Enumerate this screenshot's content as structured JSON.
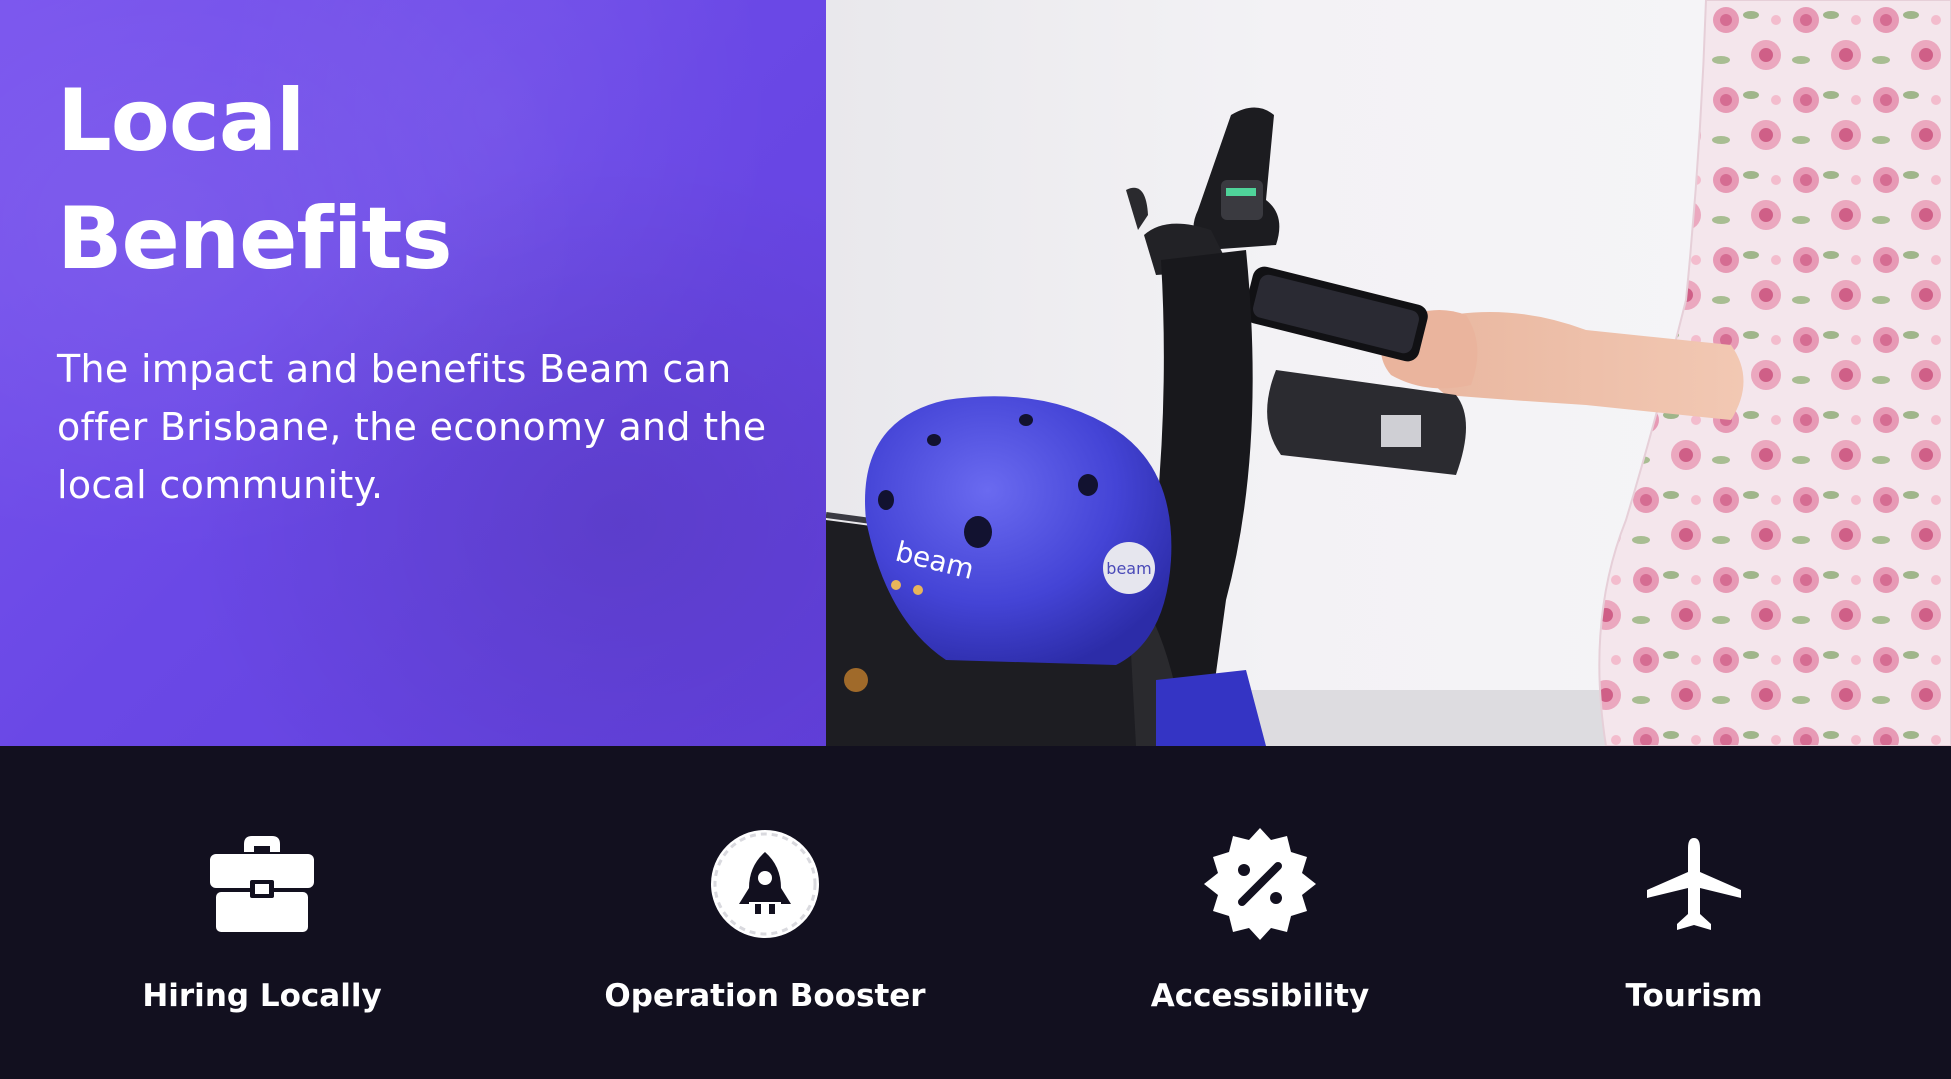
{
  "hero": {
    "title_line1": "Local",
    "title_line2": "Benefits",
    "description": "The impact and benefits Beam can offer Brisbane, the economy and the local community."
  },
  "photo": {
    "helmet_brand": "beam",
    "helmet_sticker": "beam"
  },
  "features": [
    {
      "label": "Hiring Locally",
      "icon": "briefcase-icon"
    },
    {
      "label": "Operation  Booster",
      "icon": "rocket-icon"
    },
    {
      "label": "Accessibility",
      "icon": "discount-badge-icon"
    },
    {
      "label": "Tourism",
      "icon": "airplane-icon"
    }
  ],
  "colors": {
    "purple_panel": "#6a48e6",
    "dark_band": "#12101f",
    "helmet_blue": "#4a4ad8",
    "text": "#ffffff"
  }
}
